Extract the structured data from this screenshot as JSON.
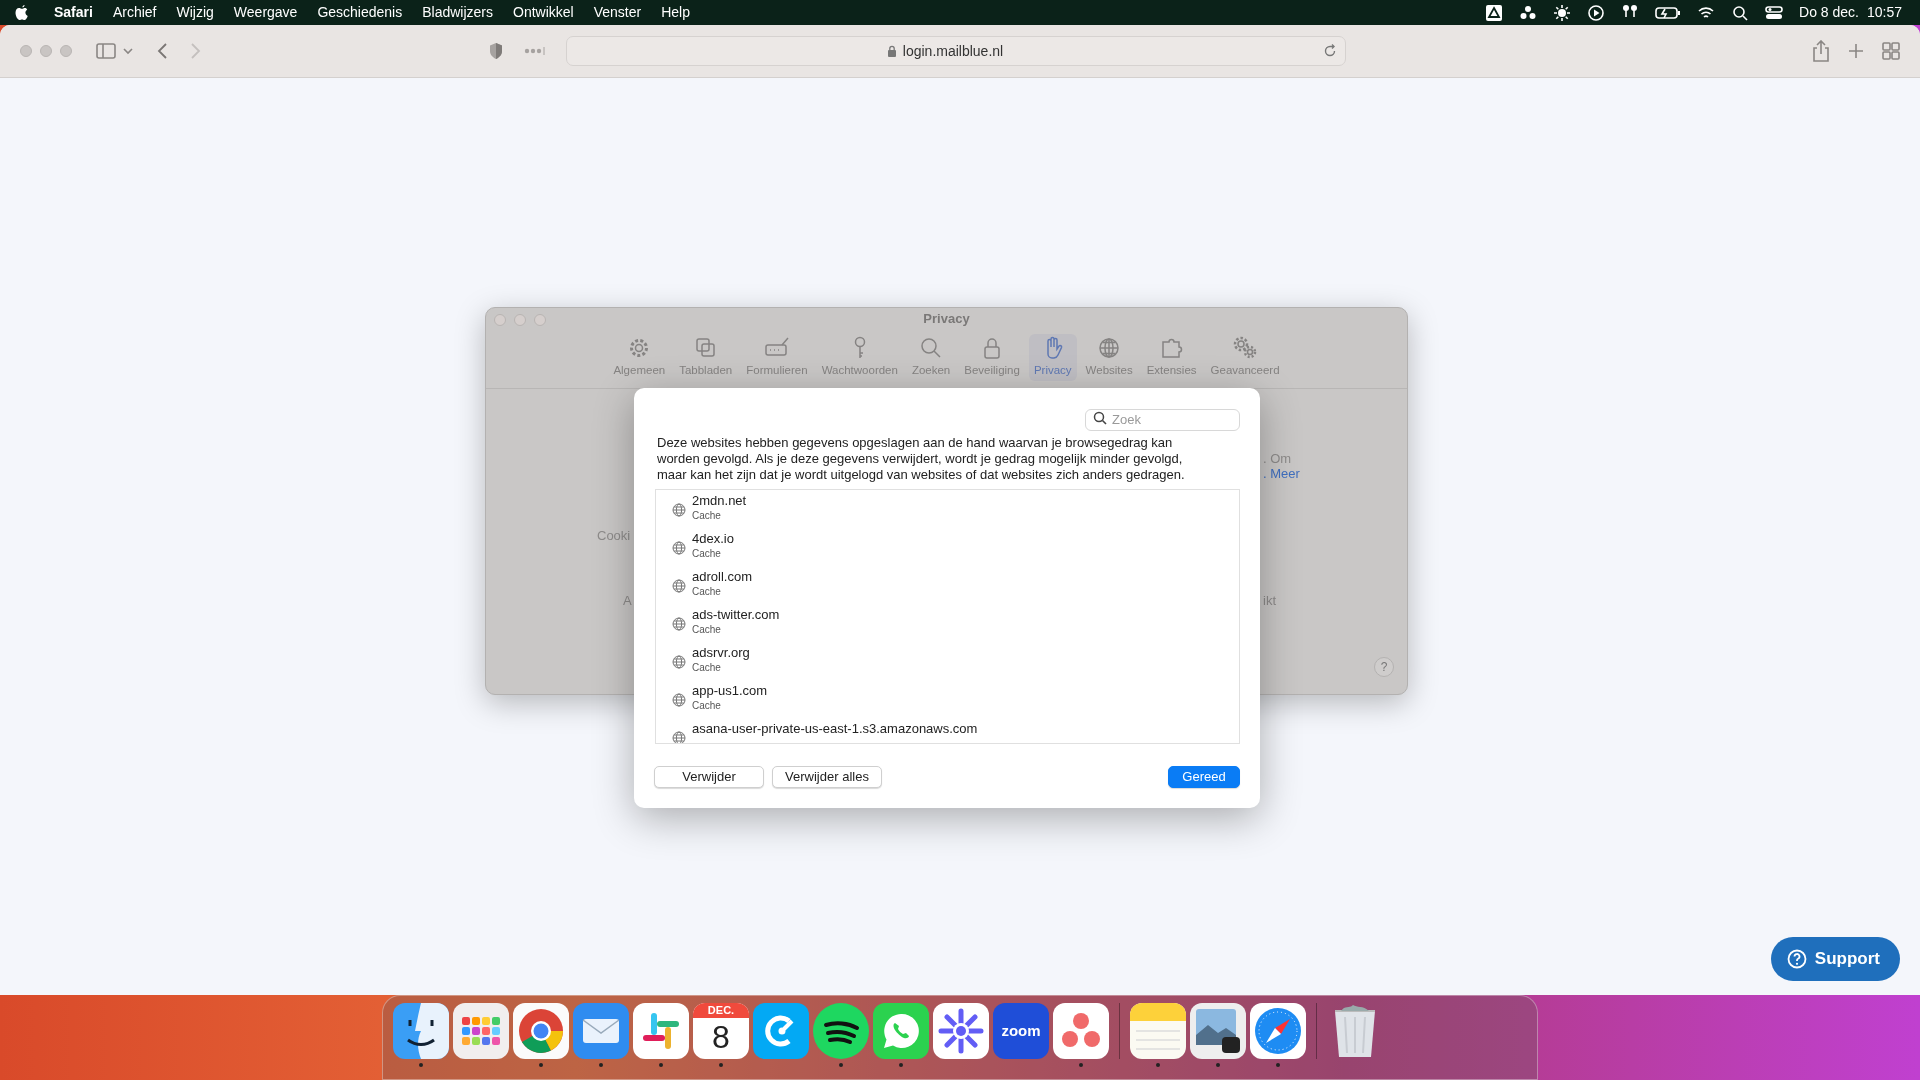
{
  "menu_bar": {
    "app": "Safari",
    "menus": [
      "Archief",
      "Wijzig",
      "Weergave",
      "Geschiedenis",
      "Bladwijzers",
      "Ontwikkel",
      "Venster",
      "Help"
    ],
    "date": "Do 8 dec.",
    "time": "10:57"
  },
  "browser": {
    "address": "login.mailblue.nl",
    "back_enabled": true,
    "forward_enabled": false
  },
  "preferences": {
    "title": "Privacy",
    "tabs": [
      {
        "label": "Algemeen",
        "selected": false
      },
      {
        "label": "Tabbladen",
        "selected": false
      },
      {
        "label": "Formulieren",
        "selected": false
      },
      {
        "label": "Wachtwoorden",
        "selected": false
      },
      {
        "label": "Zoeken",
        "selected": false
      },
      {
        "label": "Beveiliging",
        "selected": false
      },
      {
        "label": "Privacy",
        "selected": true
      },
      {
        "label": "Websites",
        "selected": false
      },
      {
        "label": "Extensies",
        "selected": false
      },
      {
        "label": "Geavanceerd",
        "selected": false
      }
    ],
    "cookies_label": "Cooki",
    "apps_label": "A",
    "note_tail": ". Om",
    "more_link": ". Meer",
    "blocked_tail": "ikt",
    "help": "?"
  },
  "dialog": {
    "search": {
      "placeholder": "Zoek"
    },
    "description": "Deze websites hebben gegevens opgeslagen aan de hand waarvan je browsegedrag kan worden gevolgd. Als je deze gegevens verwijdert, wordt je gedrag mogelijk minder gevolgd, maar kan het zijn dat je wordt uitgelogd van websites of dat websites zich anders gedragen.",
    "sites": [
      {
        "name": "2mdn.net",
        "detail": "Cache",
        "selected": false
      },
      {
        "name": "4dex.io",
        "detail": "Cache",
        "selected": false
      },
      {
        "name": "adroll.com",
        "detail": "Cache",
        "selected": false
      },
      {
        "name": "ads-twitter.com",
        "detail": "Cache",
        "selected": false
      },
      {
        "name": "adsrvr.org",
        "detail": "Cache",
        "selected": false
      },
      {
        "name": "app-us1.com",
        "detail": "Cache",
        "selected": false
      },
      {
        "name": "asana-user-private-us-east-1.s3.amazonaws.com",
        "selected": false
      }
    ],
    "buttons": [
      {
        "label": "Verwijder",
        "primary": false
      },
      {
        "label": "Verwijder alles",
        "primary": false
      },
      {
        "label": "Gereed",
        "primary": true
      }
    ]
  },
  "support_button": "Support",
  "dock": {
    "apps": [
      {
        "kind": "finder",
        "running": true
      },
      {
        "kind": "launchpad",
        "running": false
      },
      {
        "kind": "chrome",
        "running": true
      },
      {
        "kind": "mail",
        "running": true
      },
      {
        "kind": "slack",
        "running": true
      },
      {
        "kind": "calendar",
        "running": true,
        "month": "DEC.",
        "day": "8"
      },
      {
        "kind": "clockify",
        "running": false
      },
      {
        "kind": "spotify",
        "running": true
      },
      {
        "kind": "whatsapp",
        "running": true
      },
      {
        "kind": "loom",
        "running": false
      },
      {
        "kind": "zoom",
        "running": false,
        "label": "zoom"
      },
      {
        "kind": "asana",
        "running": true
      },
      {
        "kind": "separator"
      },
      {
        "kind": "notes",
        "running": true
      },
      {
        "kind": "preview",
        "running": true
      },
      {
        "kind": "safari",
        "running": true
      },
      {
        "kind": "separator"
      },
      {
        "kind": "trash"
      }
    ]
  }
}
